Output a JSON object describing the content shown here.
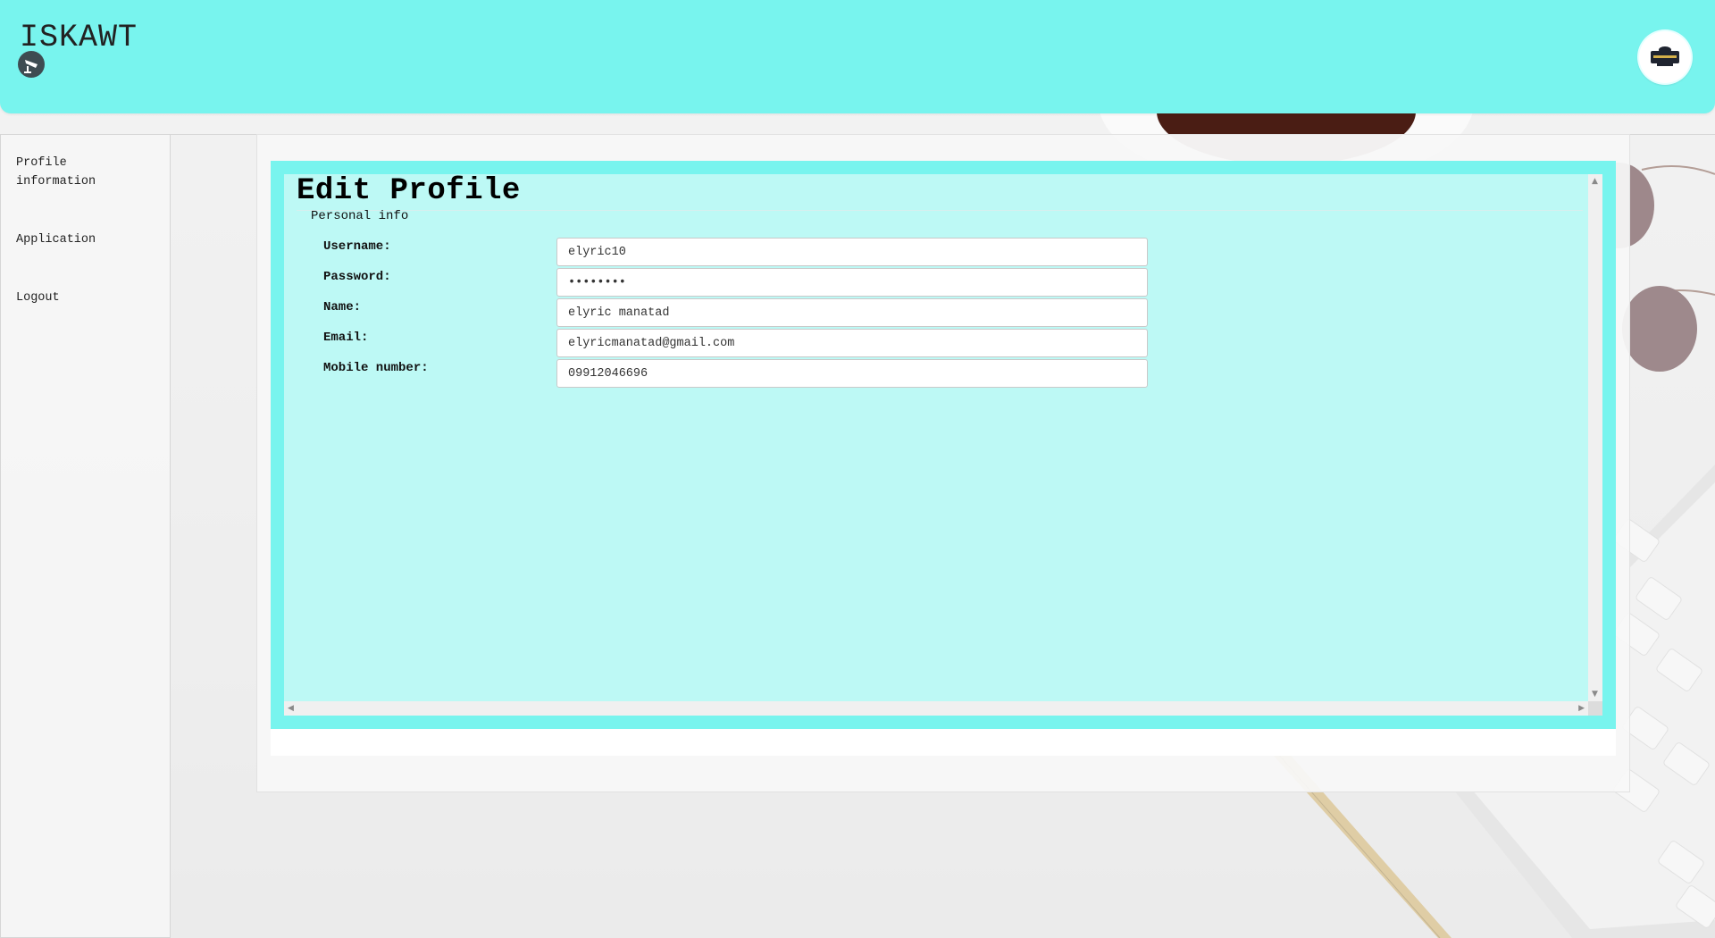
{
  "app": {
    "brand": "ISKAWT",
    "brand_icon": "cctv-camera-icon",
    "avatar_icon": "user-avatar-logo"
  },
  "sidebar": {
    "items": [
      {
        "label": "Profile information"
      },
      {
        "label": "Application"
      },
      {
        "label": "Logout"
      }
    ]
  },
  "main": {
    "title": "Edit Profile",
    "section_legend": "Personal info",
    "fields": [
      {
        "label": "Username:",
        "value": "elyric10",
        "type": "text"
      },
      {
        "label": "Password:",
        "value": "elyric10",
        "type": "password"
      },
      {
        "label": "Name:",
        "value": "elyric manatad",
        "type": "text"
      },
      {
        "label": "Email:",
        "value": "elyricmanatad@gmail.com",
        "type": "text"
      },
      {
        "label": "Mobile number:",
        "value": "09912046696",
        "type": "text"
      }
    ]
  },
  "colors": {
    "header": "#78f4ee",
    "frame": "#78f4ee",
    "frame_inner": "#bdf9f5"
  }
}
